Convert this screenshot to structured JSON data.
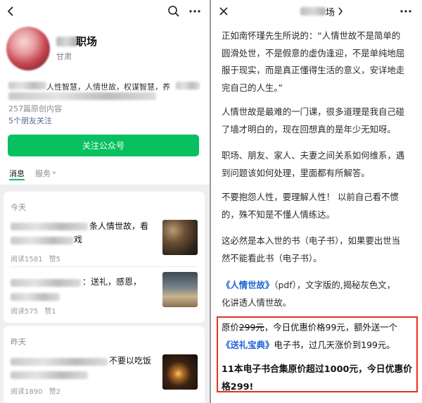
{
  "left": {
    "account": {
      "name_suffix": "职场",
      "region": "甘肃",
      "description": "人性智慧，人情世故，权谋智慧，养",
      "article_count": "257篇原创内容",
      "friends_follow": "5个朋友关注",
      "follow_button": "关注公众号"
    },
    "tabs": {
      "messages": "消息",
      "services": "服务"
    },
    "feed": [
      {
        "day": "今天",
        "articles": [
          {
            "title_line1": "条人情世故，看",
            "title_line2": "戏",
            "reads": "阅读1581",
            "likes": "赞5"
          },
          {
            "title_line1": "：送礼，感恩，",
            "title_line2": "",
            "reads": "阅读575",
            "likes": "赞1"
          }
        ]
      },
      {
        "day": "昨天",
        "articles": [
          {
            "title_line1": "不要以吃饭",
            "title_line2": "",
            "reads": "阅读1890",
            "likes": "赞2"
          }
        ]
      }
    ]
  },
  "right": {
    "header": {
      "title_suffix": "场"
    },
    "paragraphs": {
      "p1": [
        "正如南怀瑾先生所说的：“人情世故不是简单的",
        "圆滑处世，不是假意的虚伪逢迎，不是单纯地屈",
        "服于现实，而是真正懂得生活的意义，安详地走",
        "完自己的人生。”"
      ],
      "p2": [
        "人情世故是最难的一门课，很多道理是我自己碰",
        "了墙才明白的，现在回想真的是年少无知呀。"
      ],
      "p3": [
        "职场、朋友、家人、夫妻之间关系如何维系，遇",
        "到问题该如何处理，里面都有所解答。"
      ],
      "p4": [
        "不要抱怨人性，要理解人性！ 以前自己看不惯",
        "的，殊不知是不懂人情练达。"
      ],
      "p5": [
        "这必然是本入世的书（电子书），如果要出世当",
        "然不能看此书（电子书）。"
      ],
      "p6_link": "《人情世故》",
      "p6_rest": "（pdf），文字版的,揭秘灰色文，",
      "p6_line2": "化讲透人情世故。"
    },
    "promo": {
      "orig_prefix": "原价",
      "orig_price": "299元",
      "line1_rest": "，今日优惠价格99元，额外送一个",
      "gift_link": "《送礼宝典》",
      "line2_rest": "电子书，过几天涨价到199元。",
      "bold_line1": "11本电子书合集原价超过1000元，今日优惠价",
      "bold_line2": "格299!"
    }
  },
  "colors": {
    "accent_green": "#07c160",
    "link_blue": "#1e63d6",
    "promo_red": "#e8301f",
    "friends_blue": "#576b95"
  }
}
